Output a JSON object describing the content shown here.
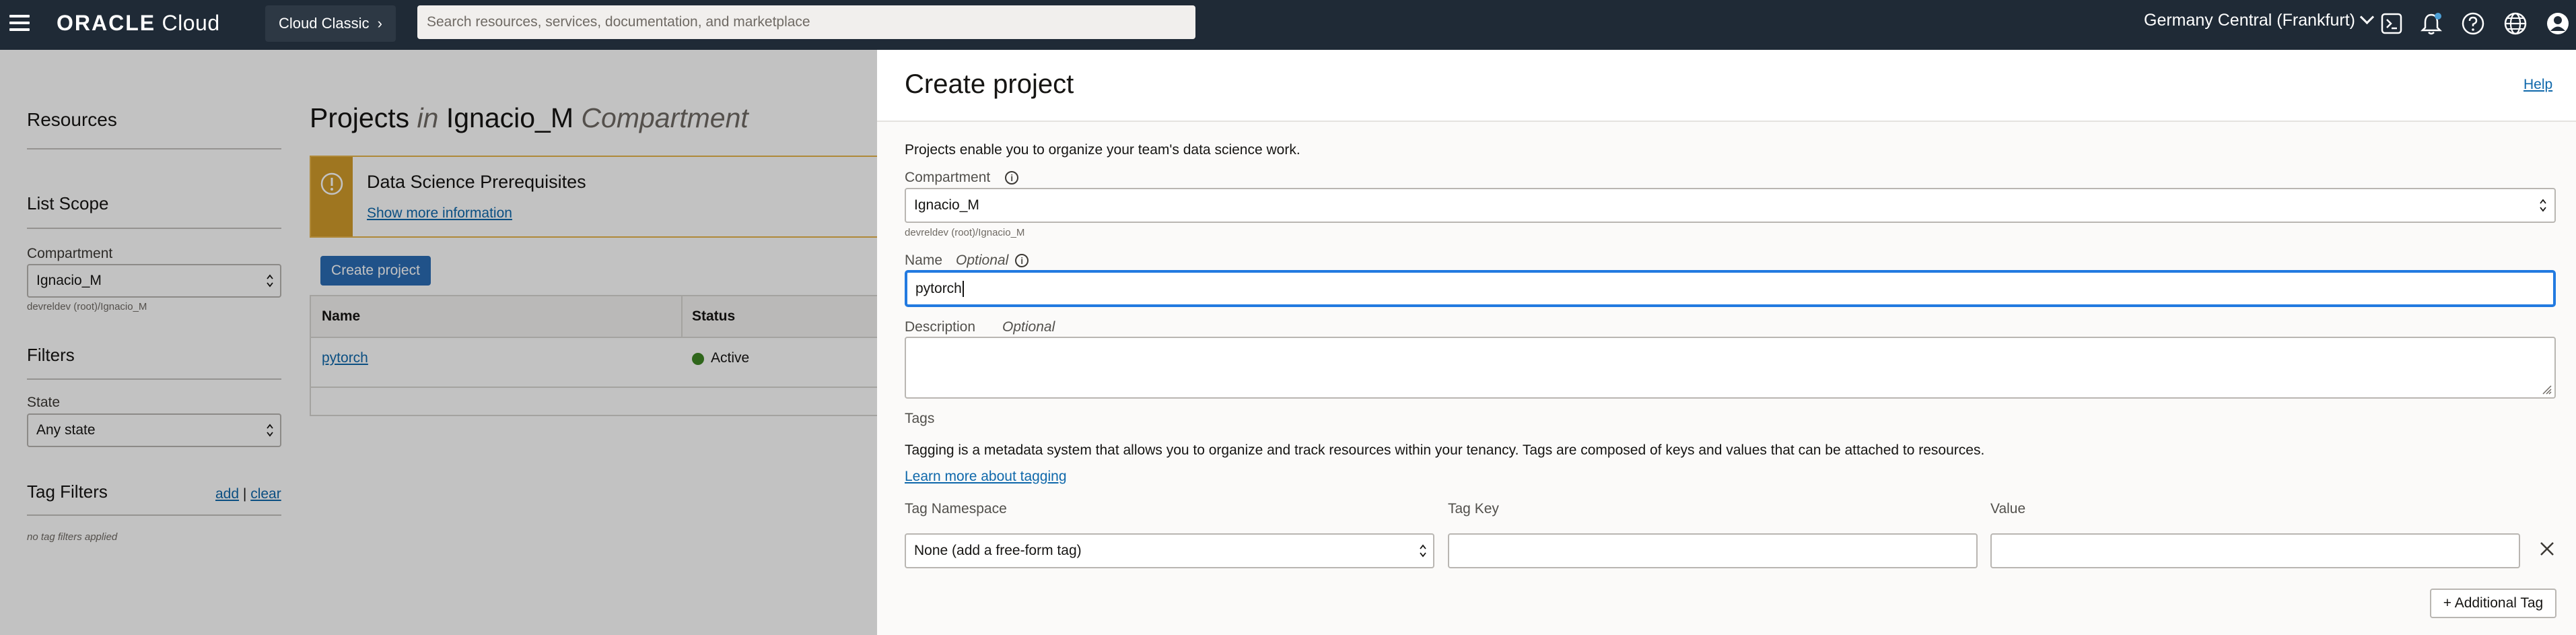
{
  "topbar": {
    "brand_strong": "ORACLE",
    "brand_light": " Cloud",
    "cloud_classic": "Cloud Classic",
    "cloud_classic_chevron": "›",
    "search_placeholder": "Search resources, services, documentation, and marketplace",
    "region": "Germany Central (Frankfurt)",
    "icons": [
      "hamburger-menu-icon",
      "cloud-shell-icon",
      "bell-icon",
      "help-icon",
      "globe-icon",
      "user-icon"
    ]
  },
  "sidebar": {
    "resources_title": "Resources",
    "list_scope_title": "List Scope",
    "compartment_label": "Compartment",
    "compartment_value": "Ignacio_M",
    "compartment_path": "devreldev (root)/Ignacio_M",
    "filters_title": "Filters",
    "state_label": "State",
    "state_value": "Any state",
    "tag_filters_title": "Tag Filters",
    "tag_add": "add",
    "tag_sep": "|",
    "tag_clear": "clear",
    "no_tag_filters": "no tag filters applied"
  },
  "main": {
    "title_projects": "Projects",
    "title_in": "in",
    "title_compartment_name": "Ignacio_M",
    "title_compartment_word": "Compartment",
    "prereq_icon": "!",
    "prereq_title": "Data Science Prerequisites",
    "prereq_link": "Show more information",
    "create_button": "Create project",
    "table": {
      "columns": [
        "Name",
        "Status"
      ],
      "rows": [
        {
          "name": "pytorch",
          "status": "Active"
        }
      ]
    }
  },
  "panel": {
    "title": "Create project",
    "help": "Help",
    "intro": "Projects enable you to organize your team's data science work.",
    "compartment_label": "Compartment",
    "compartment_value": "Ignacio_M",
    "compartment_path": "devreldev (root)/Ignacio_M",
    "name_label": "Name",
    "optional": "Optional",
    "name_value": "pytorch",
    "description_label": "Description",
    "tags_label": "Tags",
    "tags_text": "Tagging is a metadata system that allows you to organize and track resources within your tenancy. Tags are composed of keys and values that can be attached to resources.",
    "tags_link": "Learn more about tagging",
    "tag_namespace_label": "Tag Namespace",
    "tag_key_label": "Tag Key",
    "value_label": "Value",
    "tag_namespace_value": "None (add a free-form tag)",
    "additional_tag_button": "+ Additional Tag",
    "info_glyph": "i"
  },
  "colors": {
    "topbar": "#1f2a36",
    "primary_button": "#2b6cb4",
    "link": "#0f68ab",
    "focus": "#227ae0",
    "warning": "#d29b2b",
    "active": "#3f8624"
  }
}
